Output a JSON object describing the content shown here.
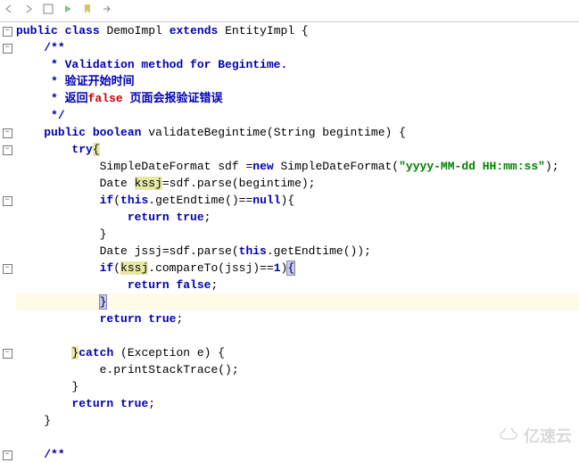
{
  "toolbar": {
    "icons": [
      "nav-back",
      "nav-fwd",
      "overview",
      "split",
      "bookmark",
      "run",
      "step",
      "stop",
      "config"
    ]
  },
  "code": {
    "class_decl": {
      "kw_public": "public",
      "kw_class": "class",
      "name": "DemoImpl",
      "kw_extends": "extends",
      "parent": "EntityImpl"
    },
    "jdoc": {
      "l1": "/**",
      "l2": " * Validation method for Begintime.",
      "l3": " * 验证开始时间",
      "l4a": " * 返回",
      "l4b": "false",
      "l4c": " 页面会报验证错误",
      "l5": " */"
    },
    "sig": {
      "kw_public": "public",
      "kw_boolean": "boolean",
      "name": "validateBegintime",
      "params": "(String begintime) {"
    },
    "try": {
      "kw": "try"
    },
    "sdf": {
      "a": "SimpleDateFormat sdf =",
      "kw_new": "new",
      "b": " SimpleDateFormat(",
      "str": "\"yyyy-MM-dd HH:mm:ss\"",
      "c": ");"
    },
    "kssj": {
      "a": "Date ",
      "var": "kssj",
      "b": "=sdf.parse(begintime);"
    },
    "if1": {
      "kw_if": "if",
      "a": "(",
      "kw_this": "this",
      "b": ".getEndtime()==",
      "kw_null": "null",
      "c": "){"
    },
    "ret_true1": {
      "kw_return": "return",
      "kw_true": "true",
      "semi": ";"
    },
    "brace1": "}",
    "jssj": "Date jssj=sdf.parse(",
    "jssj_this": "this",
    "jssj_b": ".getEndtime());",
    "if2": {
      "kw_if": "if",
      "a": "(",
      "var": "kssj",
      "b": ".compareTo(jssj)==",
      "kw_num": "1",
      "c": ")"
    },
    "ret_false": {
      "kw_return": "return",
      "kw_false": "false",
      "semi": ";"
    },
    "brace2": "}",
    "ret_true2": {
      "kw_return": "return",
      "kw_true": "true",
      "semi": ";"
    },
    "catch": {
      "kw": "catch",
      "rest": " (Exception e) {"
    },
    "trace": "e.printStackTrace();",
    "brace3": "}",
    "ret_true3": {
      "kw_return": "return",
      "kw_true": "true",
      "semi": ";"
    },
    "brace4": "}",
    "jdoc2": "/**"
  },
  "watermark": "亿速云"
}
